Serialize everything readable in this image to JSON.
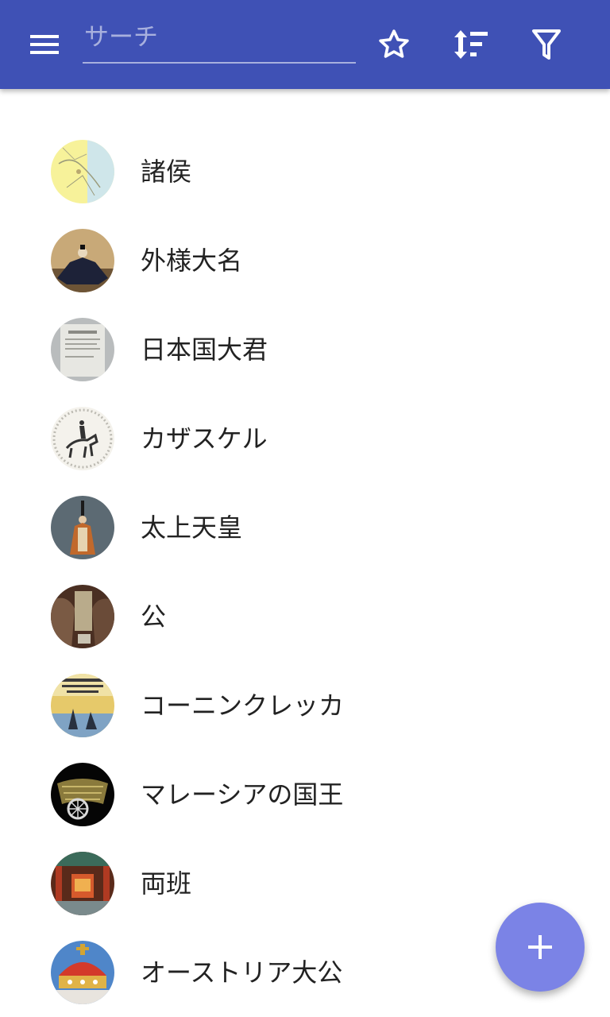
{
  "appbar": {
    "background": "#3f51b5",
    "menu_icon": "menu-icon",
    "search": {
      "placeholder": "サーチ",
      "value": ""
    },
    "actions": [
      {
        "name": "favorites",
        "icon": "star-icon"
      },
      {
        "name": "sort",
        "icon": "sort-icon"
      },
      {
        "name": "filter",
        "icon": "filter-icon"
      }
    ]
  },
  "list": {
    "items": [
      {
        "label": "諸侯",
        "thumb": "map-thumbnail"
      },
      {
        "label": "外様大名",
        "thumb": "portrait-thumbnail"
      },
      {
        "label": "日本国大君",
        "thumb": "document-thumbnail"
      },
      {
        "label": "カザスケル",
        "thumb": "horseman-engraving-thumbnail"
      },
      {
        "label": "太上天皇",
        "thumb": "robed-figure-thumbnail"
      },
      {
        "label": "公",
        "thumb": "tree-artifact-thumbnail"
      },
      {
        "label": "コーニンクレッカ",
        "thumb": "poster-thumbnail"
      },
      {
        "label": "マレーシアの国王",
        "thumb": "ornament-thumbnail"
      },
      {
        "label": "両班",
        "thumb": "temple-interior-thumbnail"
      },
      {
        "label": "オーストリア大公",
        "thumb": "crown-thumbnail"
      }
    ]
  },
  "fab": {
    "icon": "plus-icon",
    "color": "#7b83e6"
  }
}
